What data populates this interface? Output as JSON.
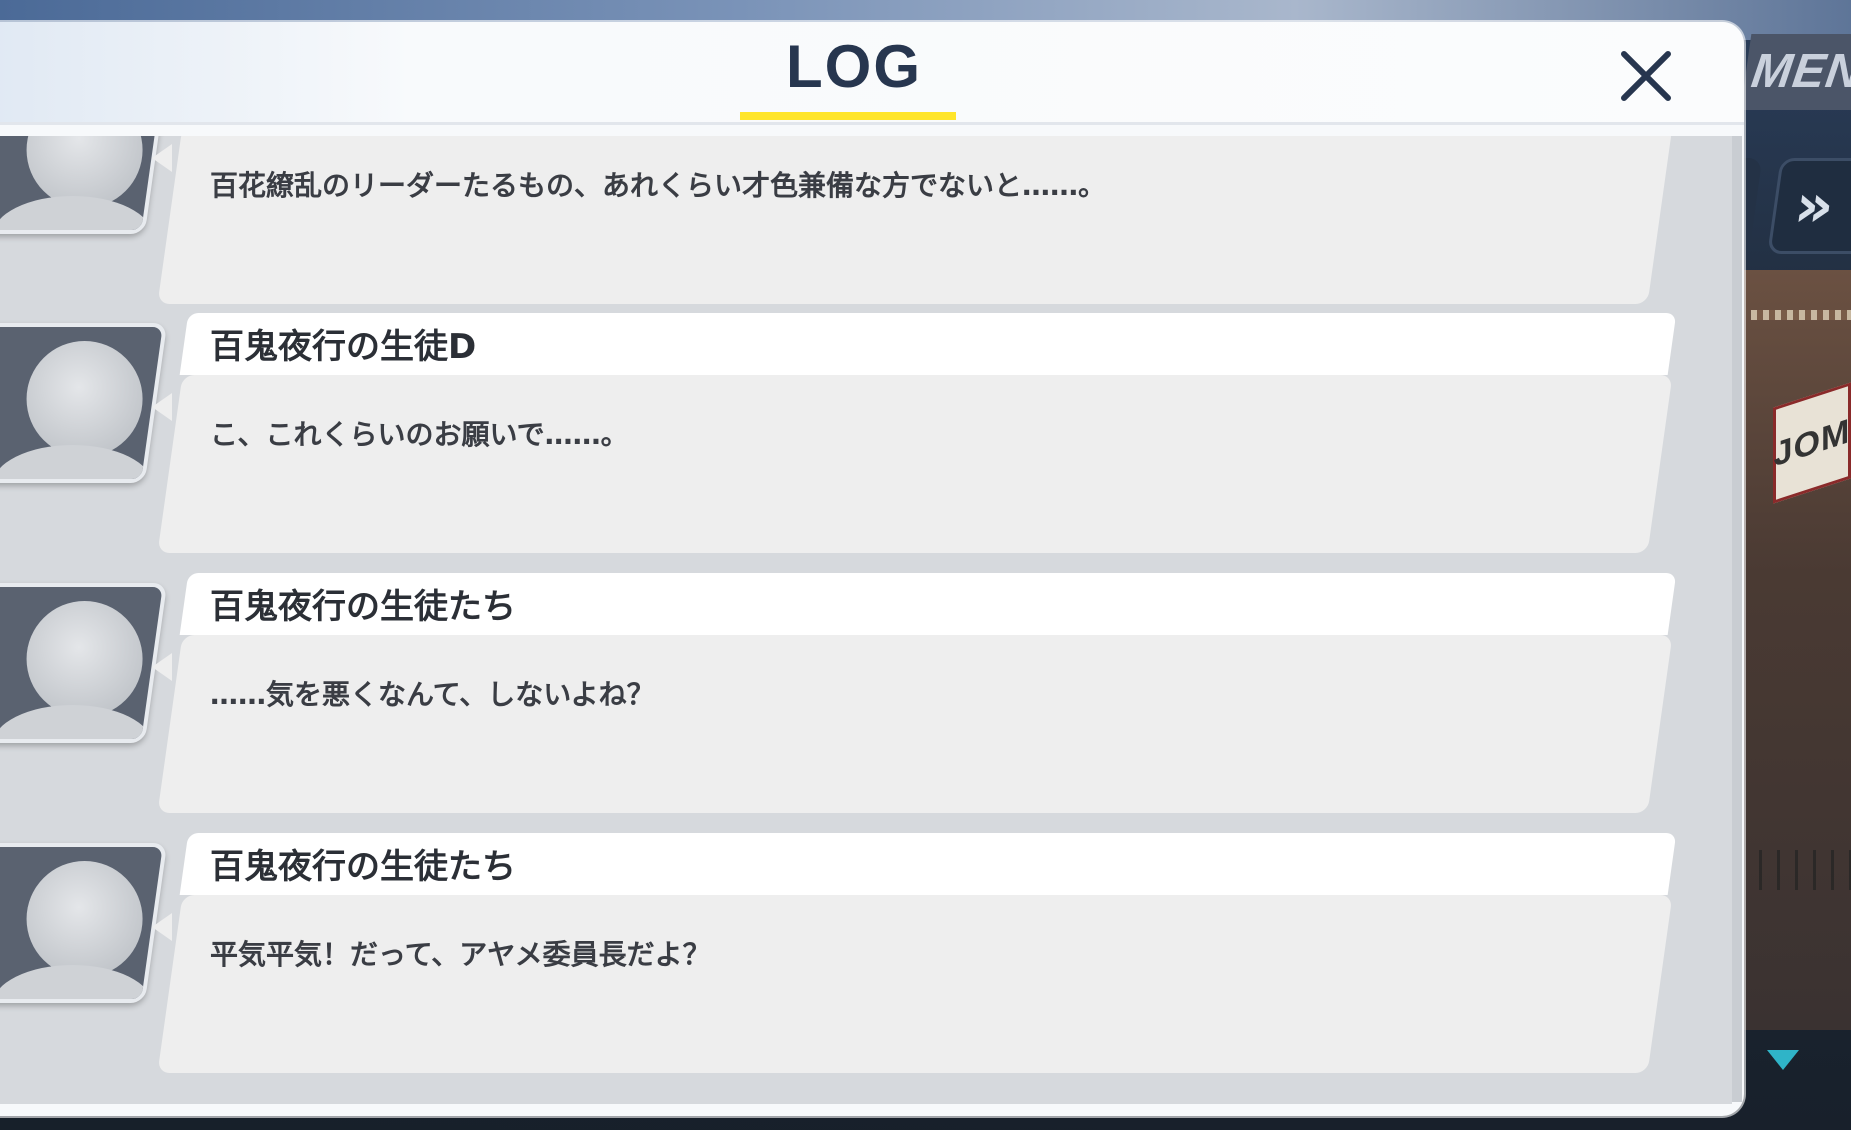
{
  "hud": {
    "menu_label": "MEN",
    "skip_label": "»"
  },
  "log": {
    "title": "LOG",
    "close_label": "×"
  },
  "background": {
    "sign_text": "JOM"
  },
  "entries": [
    {
      "name": "",
      "text": "百花繚乱のリーダーたるもの、あれくらい才色兼備な方でないと……。"
    },
    {
      "name": "百鬼夜行の生徒D",
      "text": "こ、これくらいのお願いで……。"
    },
    {
      "name": "百鬼夜行の生徒たち",
      "text": "……気を悪くなんて、しないよね？"
    },
    {
      "name": "百鬼夜行の生徒たち",
      "text": "平気平気！だって、アヤメ委員長だよ？"
    }
  ],
  "colors": {
    "accent_underline": "#ffe52a",
    "title": "#27364f",
    "scroll_indicator": "#2fb4c8"
  }
}
